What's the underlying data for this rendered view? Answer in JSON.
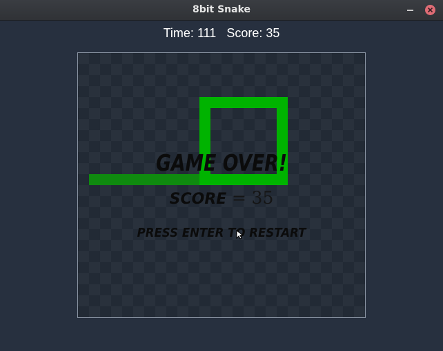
{
  "window": {
    "title": "8bit Snake"
  },
  "hud": {
    "time_label": "Time:",
    "time_value": "111",
    "score_label": "Score:",
    "score_value": "35"
  },
  "game_over": {
    "title": "GAME OVER!",
    "score_label": "SCORE",
    "score_equals": "=",
    "score_value": "35",
    "restart_prompt": "PRESS ENTER TO RESTART"
  },
  "colors": {
    "snake": "#00b300",
    "snake_tail": "#0f8a0f",
    "background": "#27303f",
    "overlay_text": "#0b0b0b"
  },
  "icons": {
    "minimize": "minimize-icon",
    "close": "close-icon",
    "cursor": "mouse-cursor-icon"
  }
}
